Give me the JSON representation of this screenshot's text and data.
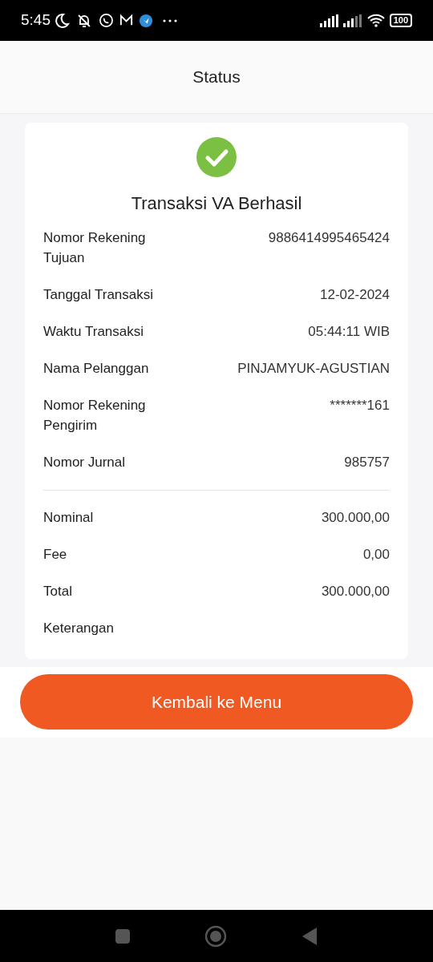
{
  "status_bar": {
    "time": "5:45",
    "battery": "100"
  },
  "header": {
    "title": "Status"
  },
  "receipt": {
    "title": "Transaksi VA Berhasil",
    "details": [
      {
        "label": "Nomor Rekening Tujuan",
        "value": "9886414995465424"
      },
      {
        "label": "Tanggal Transaksi",
        "value": "12-02-2024"
      },
      {
        "label": "Waktu Transaksi",
        "value": "05:44:11 WIB"
      },
      {
        "label": "Nama Pelanggan",
        "value": "PINJAMYUK-AGUSTIAN"
      },
      {
        "label": "Nomor Rekening Pengirim",
        "value": "*******161"
      },
      {
        "label": "Nomor Jurnal",
        "value": "985757"
      }
    ],
    "amounts": [
      {
        "label": "Nominal",
        "value": "300.000,00"
      },
      {
        "label": "Fee",
        "value": "0,00"
      },
      {
        "label": "Total",
        "value": "300.000,00"
      },
      {
        "label": "Keterangan"
      }
    ]
  },
  "button": {
    "label": "Kembali ke Menu"
  }
}
